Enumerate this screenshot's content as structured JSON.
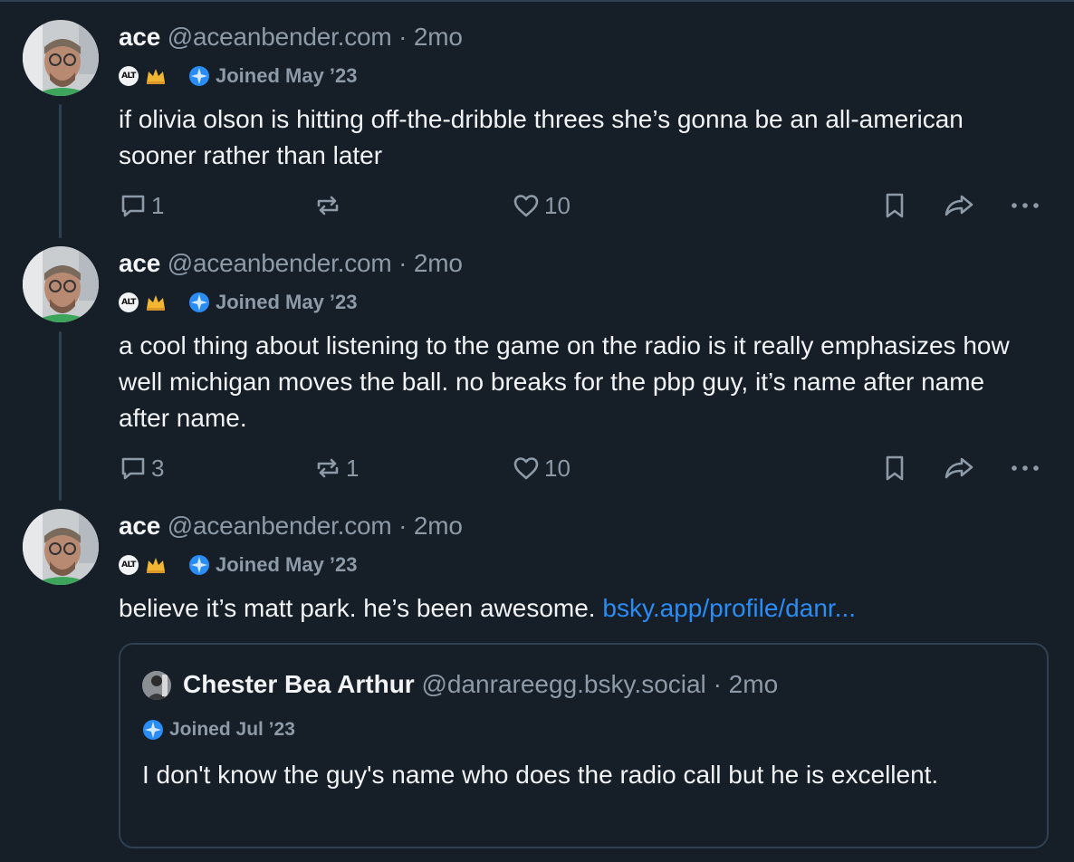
{
  "posts": [
    {
      "author_name": "ace",
      "handle": "@aceanbender.com",
      "separator": "·",
      "time": "2mo",
      "badge_alt": "ALT",
      "joined": "Joined May ’23",
      "text": "if olivia olson is hitting off-the-dribble threes she’s gonna be an all-american sooner rather than later",
      "reply_count": "1",
      "repost_count": "",
      "like_count": "10"
    },
    {
      "author_name": "ace",
      "handle": "@aceanbender.com",
      "separator": "·",
      "time": "2mo",
      "badge_alt": "ALT",
      "joined": "Joined May ’23",
      "text": "a cool thing about listening to the game on the radio is it really emphasizes how well michigan moves the ball. no breaks for the pbp guy, it’s name after name after name.",
      "reply_count": "3",
      "repost_count": "1",
      "like_count": "10"
    },
    {
      "author_name": "ace",
      "handle": "@aceanbender.com",
      "separator": "·",
      "time": "2mo",
      "badge_alt": "ALT",
      "joined": "Joined May ’23",
      "text": "believe it’s matt park. he’s been awesome. ",
      "link_text": "bsky.app/profile/danr..."
    }
  ],
  "quote": {
    "author_name": "Chester Bea Arthur",
    "handle": "@danrareegg.bsky.social",
    "separator": "·",
    "time": "2mo",
    "joined": "Joined Jul ’23",
    "text": "I don't know the guy's name who does the radio call but he is excellent."
  },
  "colors": {
    "background": "#161e27",
    "text": "#f1f3f5",
    "muted": "#8d9aa8",
    "border": "#2e4052",
    "link": "#2a8cf5"
  },
  "icons": [
    "reply-icon",
    "repost-icon",
    "like-icon",
    "bookmark-icon",
    "share-icon",
    "more-icon",
    "crown-icon",
    "joined-badge-icon"
  ]
}
